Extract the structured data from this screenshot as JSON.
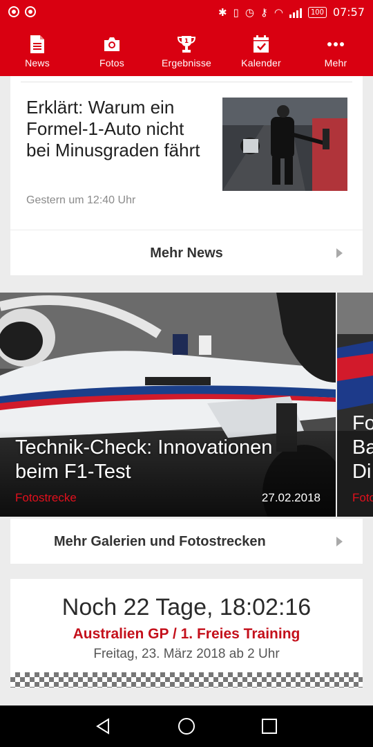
{
  "status_bar": {
    "time": "07:57",
    "battery": "100"
  },
  "nav": {
    "items": [
      {
        "label": "News",
        "icon": "document-icon"
      },
      {
        "label": "Fotos",
        "icon": "camera-icon"
      },
      {
        "label": "Ergebnisse",
        "icon": "trophy-icon"
      },
      {
        "label": "Kalender",
        "icon": "calendar-icon"
      },
      {
        "label": "Mehr",
        "icon": "more-dots-icon"
      }
    ]
  },
  "news": {
    "title": "Erklärt: Warum ein Formel-1-Auto nicht bei Minusgraden fährt",
    "time": "Gestern um 12:40 Uhr",
    "more_label": "Mehr News"
  },
  "gallery": {
    "slide": {
      "title": "Technik-Check: Innovationen beim F1-Test",
      "category": "Fotostrecke",
      "date": "27.02.2018"
    },
    "next_slide": {
      "title": "Fo\nBa\nDi",
      "category": "Foto"
    },
    "more_label": "Mehr Galerien und Fotostrecken"
  },
  "countdown": {
    "time": "Noch 22 Tage, 18:02:16",
    "event": "Australien GP / 1. Freies Training",
    "date": "Freitag, 23. März 2018 ab 2 Uhr"
  },
  "colors": {
    "brand_red": "#d90011",
    "accent_red": "#c4101b"
  }
}
